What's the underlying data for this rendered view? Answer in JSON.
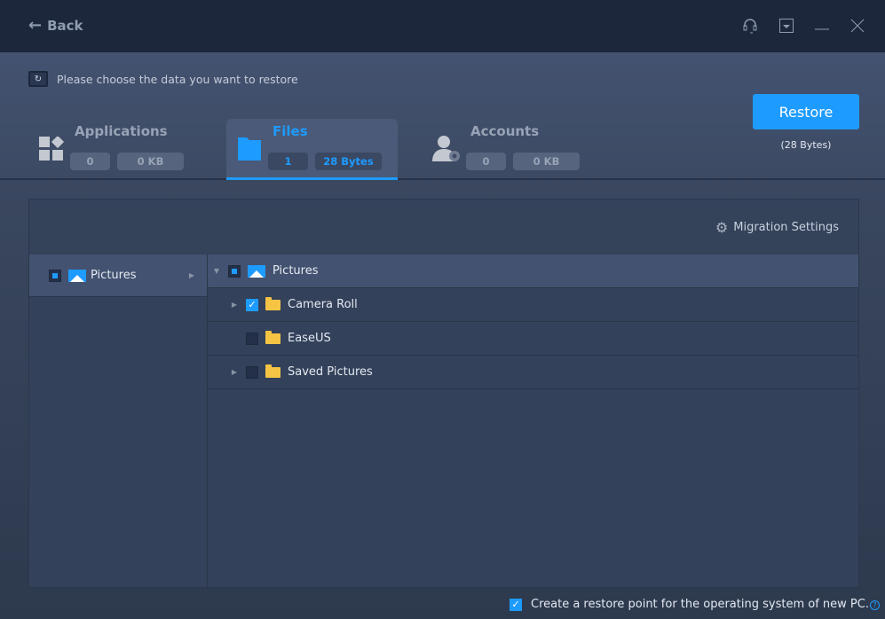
{
  "titlebar": {
    "back_label": "Back",
    "icons": [
      "headset-icon",
      "menu-dropdown-icon",
      "minimize-icon",
      "close-icon"
    ]
  },
  "header": {
    "prompt": "Please choose the data you want to restore",
    "tabs": [
      {
        "label": "Applications",
        "count": "0",
        "size": "0 KB",
        "icon": "apps-icon",
        "active": false
      },
      {
        "label": "Files",
        "count": "1",
        "size": "28 Bytes",
        "icon": "folder-icon",
        "active": true
      },
      {
        "label": "Accounts",
        "count": "0",
        "size": "0 KB",
        "icon": "account-settings-icon",
        "active": false
      }
    ],
    "restore_label": "Restore",
    "restore_size": "(28 Bytes)"
  },
  "panel": {
    "migration_settings": "Migration Settings",
    "left_items": [
      {
        "label": "Pictures",
        "state": "partial"
      }
    ],
    "tree": [
      {
        "label": "Pictures",
        "state": "partial",
        "expanded": true,
        "level": 0
      },
      {
        "label": "Camera Roll",
        "state": "checked",
        "expandable": true,
        "level": 1
      },
      {
        "label": "EaseUS",
        "state": "unchecked",
        "expandable": false,
        "level": 1
      },
      {
        "label": "Saved Pictures",
        "state": "unchecked",
        "expandable": true,
        "level": 1
      }
    ]
  },
  "footer": {
    "restore_point_label": "Create a restore point for the operating system of new PC.",
    "restore_point_checked": true,
    "help": "?"
  },
  "colors": {
    "accent": "#1e9bff",
    "titlebar": "#1c273b",
    "folder": "#f6c444"
  }
}
